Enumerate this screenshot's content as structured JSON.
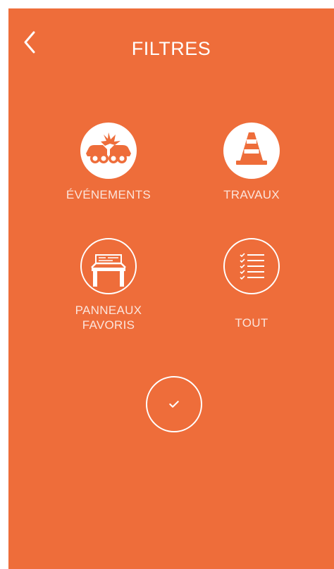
{
  "header": {
    "title": "FILTRES",
    "back_icon": "chevron-left-icon"
  },
  "filters": [
    {
      "label": "ÉVÉNEMENTS",
      "icon": "car-crash-icon",
      "selected": true
    },
    {
      "label": "TRAVAUX",
      "icon": "traffic-cone-icon",
      "selected": true
    },
    {
      "label_lines": [
        "PANNEAUX",
        "FAVORIS"
      ],
      "icon": "road-sign-icon",
      "selected": false
    },
    {
      "label": "TOUT",
      "icon": "checklist-icon",
      "selected": false
    }
  ],
  "confirm": {
    "icon": "check-icon"
  },
  "colors": {
    "background": "#ee6d3a",
    "foreground": "#ffffff"
  }
}
